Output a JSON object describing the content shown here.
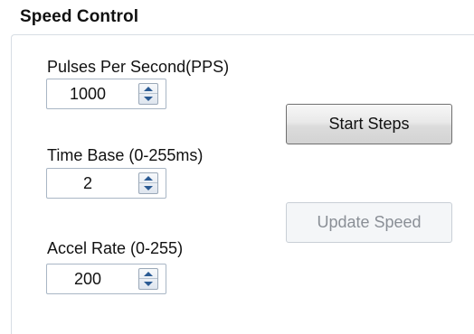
{
  "group": {
    "title": "Speed Control"
  },
  "fields": {
    "pps": {
      "label": "Pulses Per Second(PPS)",
      "value": "1000"
    },
    "time_base": {
      "label": "Time Base (0-255ms)",
      "value": "2"
    },
    "accel_rate": {
      "label": "Accel Rate (0-255)",
      "value": "200"
    }
  },
  "buttons": {
    "start_steps": {
      "label": "Start Steps",
      "enabled": true
    },
    "update_speed": {
      "label": "Update Speed",
      "enabled": false
    }
  },
  "icons": {
    "spin_up": "spin-up-arrow-icon",
    "spin_down": "spin-down-arrow-icon"
  },
  "colors": {
    "spinner_arrow": "#2a5a93",
    "disabled_text": "#8a8f96"
  }
}
